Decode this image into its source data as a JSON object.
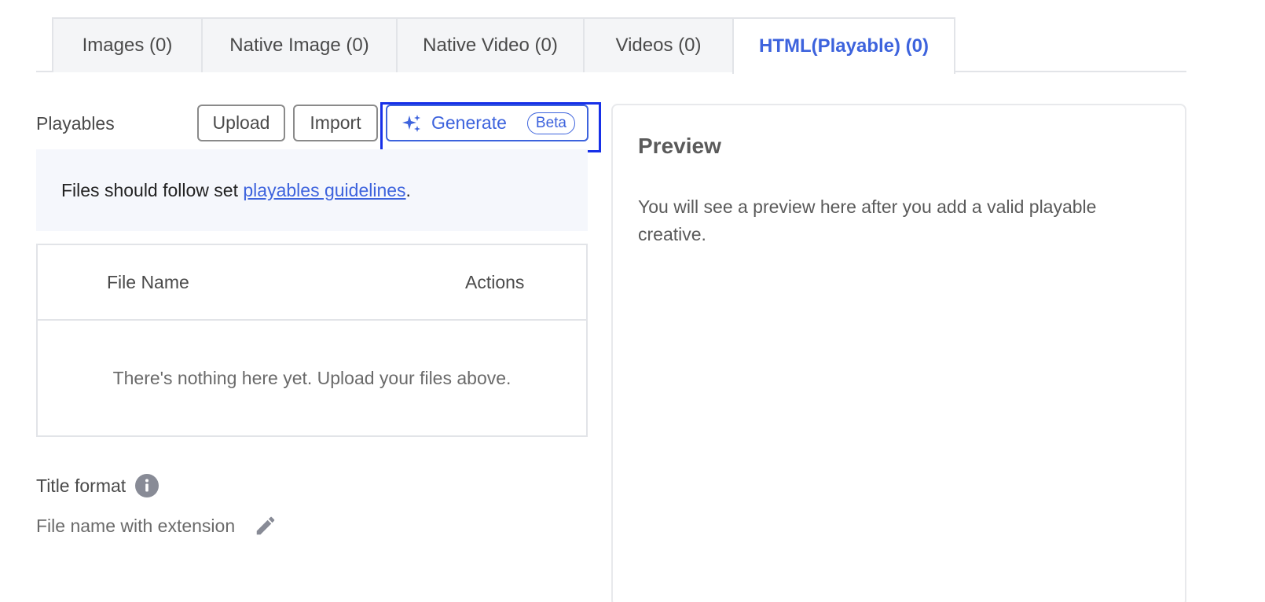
{
  "tabs": [
    {
      "label": "Images (0)"
    },
    {
      "label": "Native Image (0)"
    },
    {
      "label": "Native Video (0)"
    },
    {
      "label": "Videos (0)"
    },
    {
      "label": "HTML(Playable) (0)",
      "active": true
    }
  ],
  "colors": {
    "accent": "#3d63dd",
    "highlight_box": "#1730e8",
    "banner_bg": "#f5f7fc"
  },
  "playables": {
    "label": "Playables",
    "upload_label": "Upload",
    "import_label": "Import",
    "generate_label": "Generate",
    "beta_label": "Beta",
    "generate_icon": "sparkle-icon"
  },
  "banner": {
    "prefix": "Files should follow set ",
    "link_text": "playables guidelines",
    "suffix": "."
  },
  "table": {
    "columns": [
      "File Name",
      "Actions"
    ],
    "empty_text": "There's nothing here yet. Upload your files above."
  },
  "title_format": {
    "label": "Title format",
    "info_icon": "info-icon",
    "value": "File name with extension",
    "edit_icon": "pencil-icon"
  },
  "preview": {
    "title": "Preview",
    "text": "You will see a preview here after you add a valid playable creative."
  }
}
